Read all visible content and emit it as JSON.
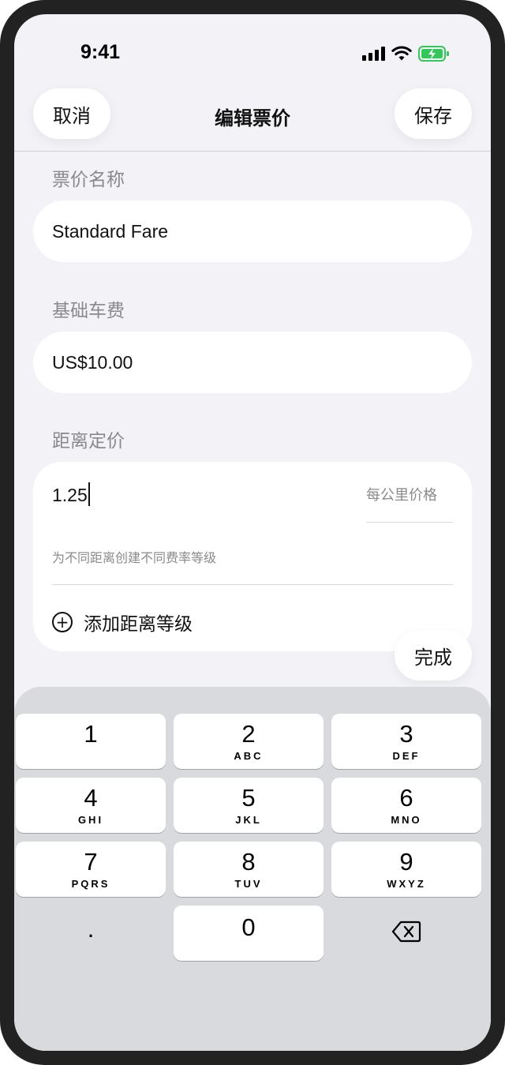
{
  "status_bar": {
    "time": "9:41"
  },
  "nav": {
    "cancel_label": "取消",
    "title": "编辑票价",
    "save_label": "保存"
  },
  "form": {
    "fare_name": {
      "label": "票价名称",
      "value": "Standard Fare"
    },
    "base_fare": {
      "label": "基础车费",
      "value": "US$10.00"
    },
    "distance_pricing": {
      "label": "距离定价",
      "rate_value": "1.25",
      "rate_unit": "每公里价格",
      "hint": "为不同距离创建不同费率等级",
      "add_tier_label": "添加距离等级"
    }
  },
  "done_label": "完成",
  "keyboard": {
    "keys": [
      {
        "num": "1",
        "letters": ""
      },
      {
        "num": "2",
        "letters": "ABC"
      },
      {
        "num": "3",
        "letters": "DEF"
      },
      {
        "num": "4",
        "letters": "GHI"
      },
      {
        "num": "5",
        "letters": "JKL"
      },
      {
        "num": "6",
        "letters": "MNO"
      },
      {
        "num": "7",
        "letters": "PQRS"
      },
      {
        "num": "8",
        "letters": "TUV"
      },
      {
        "num": "9",
        "letters": "WXYZ"
      }
    ],
    "decimal": ".",
    "zero": "0"
  },
  "icons": {
    "signal": "cellular-signal-icon",
    "wifi": "wifi-icon",
    "battery": "battery-charging-icon",
    "add": "plus-circle-icon",
    "delete": "backspace-icon"
  },
  "colors": {
    "battery_fill": "#34c759",
    "background": "#f2f2f7",
    "keyboard": "#d8dadd"
  }
}
